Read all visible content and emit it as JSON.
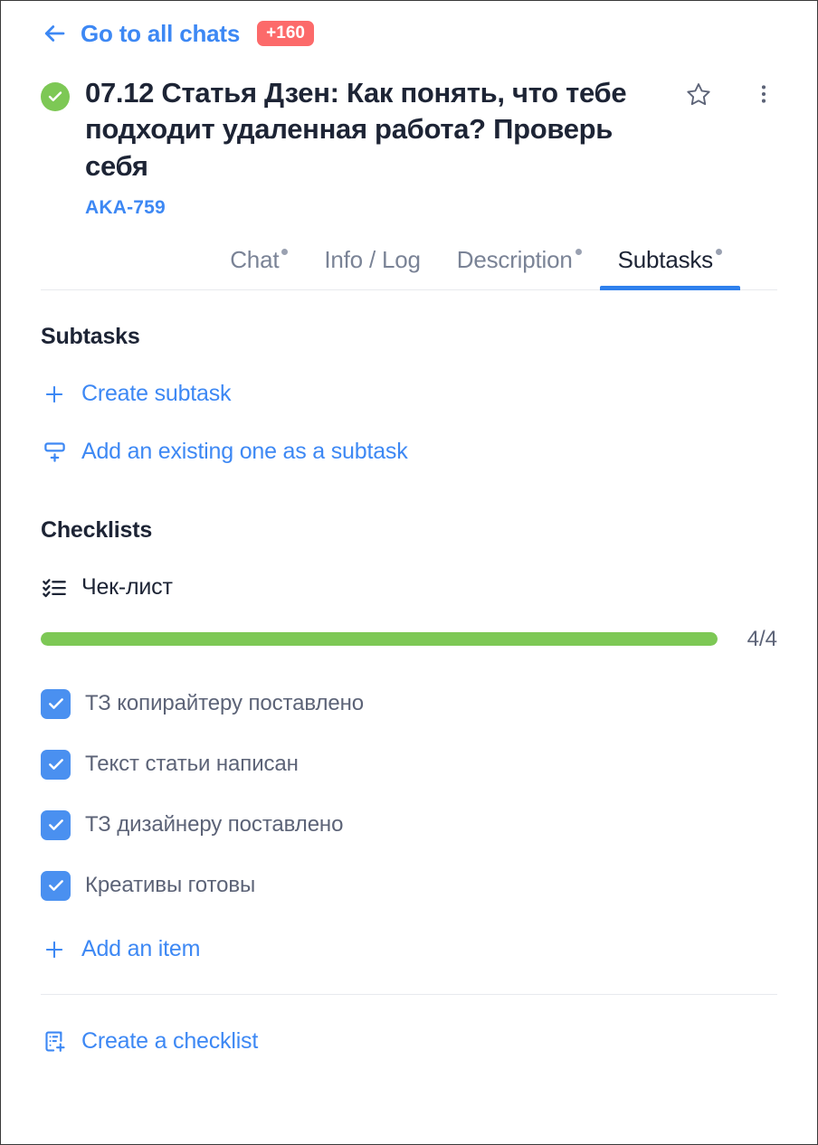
{
  "header": {
    "back_label": "Go to all chats",
    "back_icon": "arrow-left-icon",
    "unread_badge": "+160",
    "status_icon": "check-circle-icon",
    "task_title": "07.12 Статья Дзен: Как понять, что тебе подходит удаленная работа? Проверь себя",
    "task_key": "AKA-759",
    "star_icon": "star-outline-icon",
    "more_icon": "more-vertical-icon"
  },
  "tabs": [
    {
      "label": "Chat",
      "has_dot": true,
      "active": false
    },
    {
      "label": "Info / Log",
      "has_dot": false,
      "active": false
    },
    {
      "label": "Description",
      "has_dot": true,
      "active": false
    },
    {
      "label": "Subtasks",
      "has_dot": true,
      "active": true
    }
  ],
  "subtasks": {
    "heading": "Subtasks",
    "create_label": "Create subtask",
    "create_icon": "plus-icon",
    "add_existing_label": "Add an existing one as a subtask",
    "add_existing_icon": "add-below-icon"
  },
  "checklists": {
    "heading": "Checklists",
    "list_icon": "checklist-icon",
    "name": "Чек-лист",
    "progress_label": "4/4",
    "progress_done": 4,
    "progress_total": 4,
    "progress_percent": 100,
    "items": [
      {
        "label": "ТЗ копирайтеру поставлено",
        "checked": true
      },
      {
        "label": "Текст статьи написан",
        "checked": true
      },
      {
        "label": "ТЗ дизайнеру поставлено",
        "checked": true
      },
      {
        "label": "Креативы готовы",
        "checked": true
      }
    ],
    "add_item_label": "Add an item",
    "add_item_icon": "plus-icon",
    "create_checklist_label": "Create a checklist",
    "create_checklist_icon": "document-add-icon"
  },
  "colors": {
    "accent_blue": "#3d88f4",
    "tab_active_underline": "#2f80ed",
    "badge_red": "#fc6a6a",
    "status_green": "#7dc855",
    "progress_green": "#7dc855",
    "checkbox_blue": "#4a90f0",
    "text_dark": "#1d2435",
    "text_muted": "#5c6377"
  }
}
